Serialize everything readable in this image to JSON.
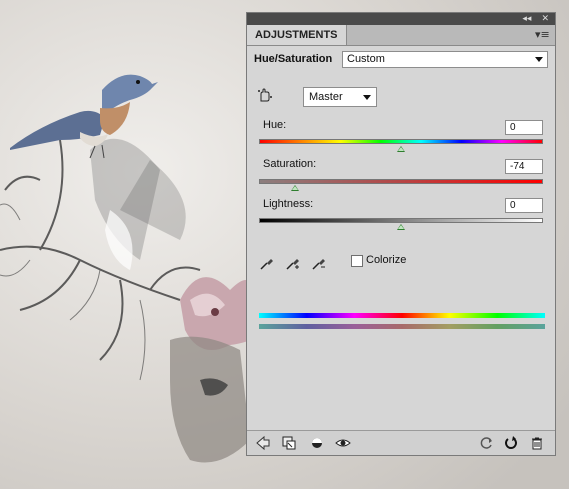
{
  "panel": {
    "tab_label": "ADJUSTMENTS",
    "topbar": {
      "collapse_icon": "double-left-arrow",
      "close_icon": "close-x"
    },
    "menu_icon": "panel-menu-icon"
  },
  "adjustment": {
    "title": "Hue/Saturation",
    "preset": "Custom",
    "channel": "Master",
    "hue": {
      "label": "Hue:",
      "value": "0",
      "level": 0
    },
    "saturation": {
      "label": "Saturation:",
      "value": "-74",
      "level": -74
    },
    "lightness": {
      "label": "Lightness:",
      "value": "0",
      "level": 0
    },
    "colorize_label": "Colorize",
    "colorize_checked": false
  },
  "colors": {
    "panel_bg": "#d6d6d6",
    "thumb": "#2e7d2e"
  },
  "footer": {
    "icons": [
      "back-arrow-icon",
      "clip-to-layer-icon",
      "visibility-mask-icon",
      "eye-icon",
      "reset-view-icon",
      "reset-icon",
      "trash-icon"
    ]
  }
}
